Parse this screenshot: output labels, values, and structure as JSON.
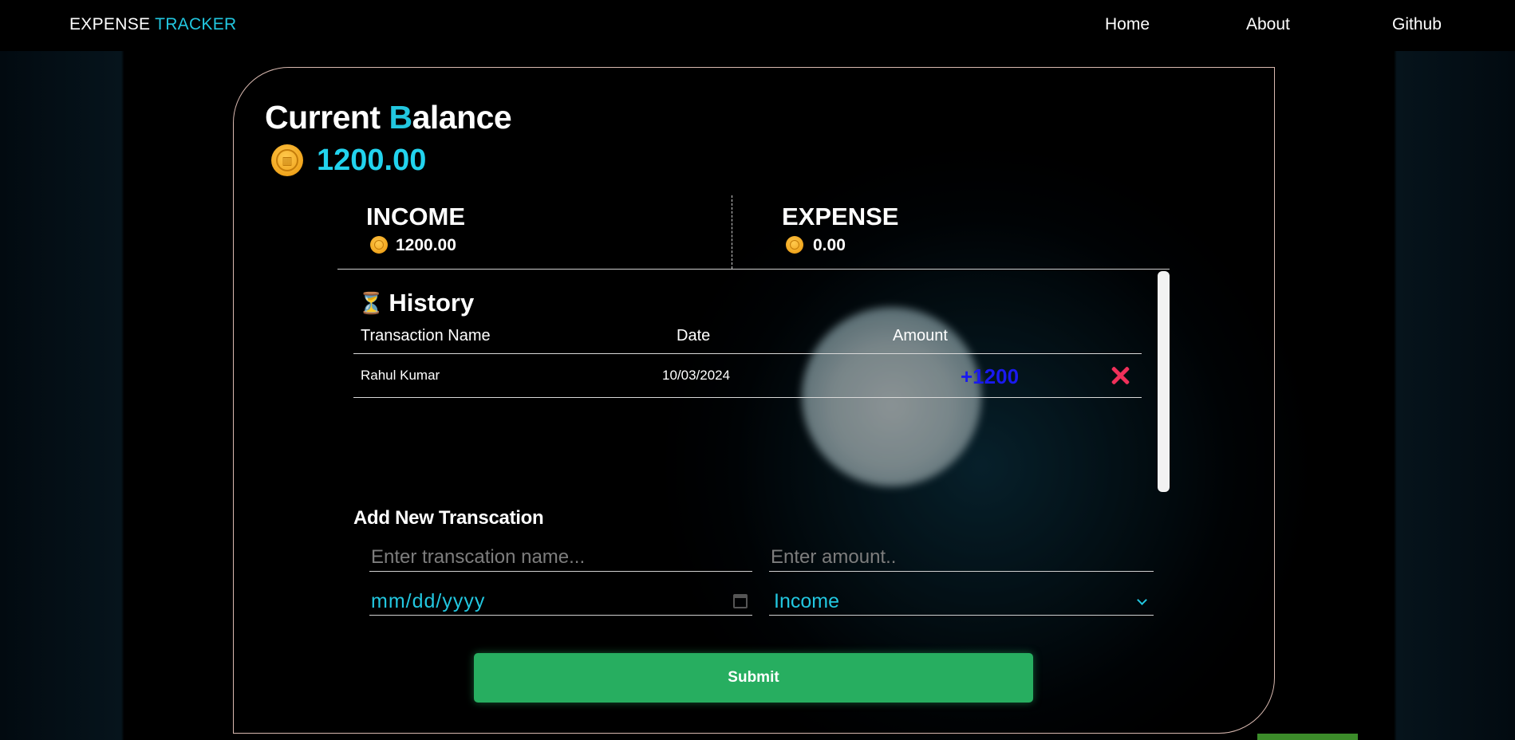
{
  "navbar": {
    "brand_part1": "EXPENSE ",
    "brand_part2": "TRACKER",
    "links": [
      "Home",
      "About",
      "Github"
    ]
  },
  "balance": {
    "title_part1": "Current ",
    "title_accent": "B",
    "title_part2": "alance",
    "amount": "1200.00"
  },
  "summary": {
    "income_label": "INCOME",
    "income_value": "1200.00",
    "expense_label": "EXPENSE",
    "expense_value": "0.00"
  },
  "history": {
    "title": "History",
    "columns": [
      "Transaction Name",
      "Date",
      "Amount"
    ],
    "rows": [
      {
        "name": "Rahul Kumar",
        "date": "10/03/2024",
        "amount": "+1200"
      }
    ]
  },
  "form": {
    "title": "Add New Transcation",
    "name_placeholder": "Enter transcation name...",
    "amount_placeholder": "Enter amount..",
    "date_value": "mm/dd/yyyy",
    "type_value": "Income",
    "submit_label": "Submit"
  },
  "colors": {
    "accent": "#22c7e0",
    "submit": "#27ae60",
    "amount": "#1a1af0",
    "delete": "#f0305a"
  }
}
